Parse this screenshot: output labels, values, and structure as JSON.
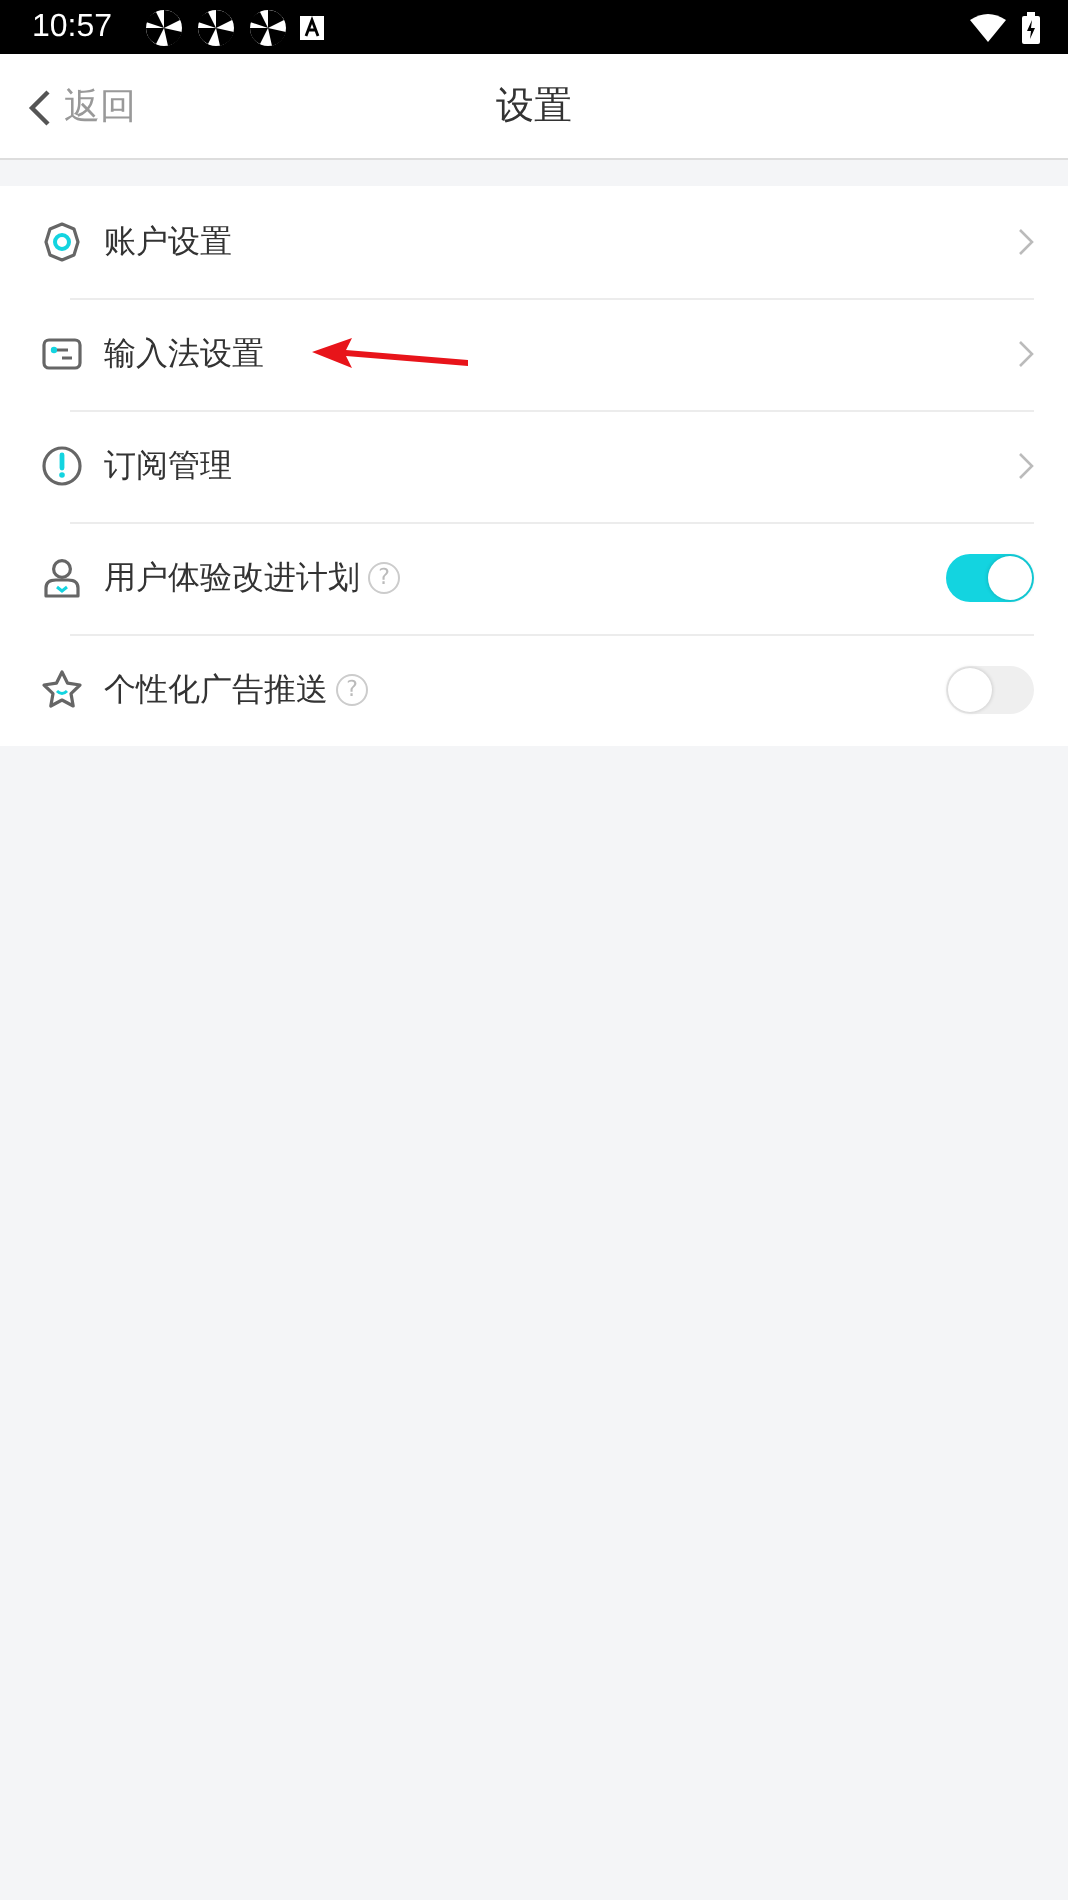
{
  "status_bar": {
    "time": "10:57"
  },
  "header": {
    "back": "返回",
    "title": "设置"
  },
  "settings": [
    {
      "kind": "link",
      "label": "账户设置"
    },
    {
      "kind": "link",
      "label": "输入法设置"
    },
    {
      "kind": "link",
      "label": "订阅管理"
    },
    {
      "kind": "toggle",
      "label": "用户体验改进计划",
      "help": "?",
      "on": true
    },
    {
      "kind": "toggle",
      "label": "个性化广告推送",
      "help": "?",
      "on": false
    }
  ]
}
